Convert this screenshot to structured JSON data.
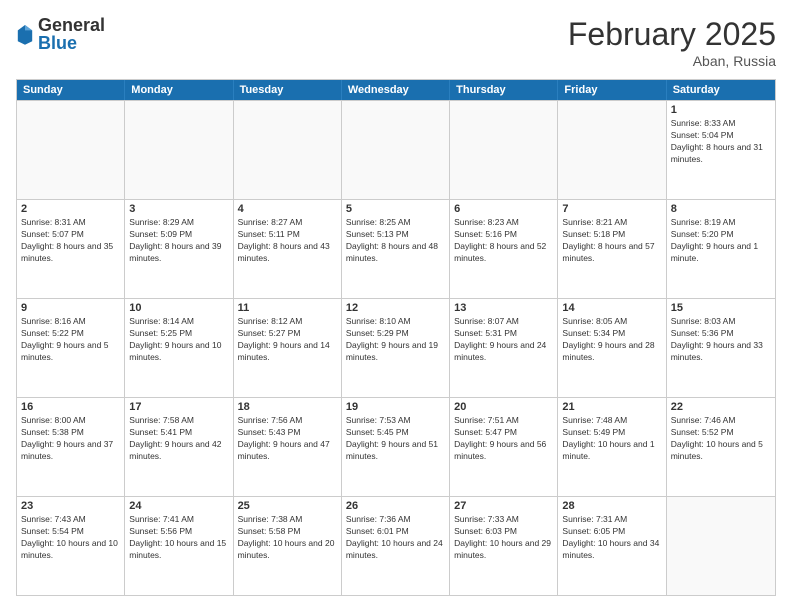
{
  "header": {
    "logo": {
      "general": "General",
      "blue": "Blue"
    },
    "title": "February 2025",
    "location": "Aban, Russia"
  },
  "weekdays": [
    "Sunday",
    "Monday",
    "Tuesday",
    "Wednesday",
    "Thursday",
    "Friday",
    "Saturday"
  ],
  "rows": [
    [
      {
        "date": "",
        "info": ""
      },
      {
        "date": "",
        "info": ""
      },
      {
        "date": "",
        "info": ""
      },
      {
        "date": "",
        "info": ""
      },
      {
        "date": "",
        "info": ""
      },
      {
        "date": "",
        "info": ""
      },
      {
        "date": "1",
        "info": "Sunrise: 8:33 AM\nSunset: 5:04 PM\nDaylight: 8 hours and 31 minutes."
      }
    ],
    [
      {
        "date": "2",
        "info": "Sunrise: 8:31 AM\nSunset: 5:07 PM\nDaylight: 8 hours and 35 minutes."
      },
      {
        "date": "3",
        "info": "Sunrise: 8:29 AM\nSunset: 5:09 PM\nDaylight: 8 hours and 39 minutes."
      },
      {
        "date": "4",
        "info": "Sunrise: 8:27 AM\nSunset: 5:11 PM\nDaylight: 8 hours and 43 minutes."
      },
      {
        "date": "5",
        "info": "Sunrise: 8:25 AM\nSunset: 5:13 PM\nDaylight: 8 hours and 48 minutes."
      },
      {
        "date": "6",
        "info": "Sunrise: 8:23 AM\nSunset: 5:16 PM\nDaylight: 8 hours and 52 minutes."
      },
      {
        "date": "7",
        "info": "Sunrise: 8:21 AM\nSunset: 5:18 PM\nDaylight: 8 hours and 57 minutes."
      },
      {
        "date": "8",
        "info": "Sunrise: 8:19 AM\nSunset: 5:20 PM\nDaylight: 9 hours and 1 minute."
      }
    ],
    [
      {
        "date": "9",
        "info": "Sunrise: 8:16 AM\nSunset: 5:22 PM\nDaylight: 9 hours and 5 minutes."
      },
      {
        "date": "10",
        "info": "Sunrise: 8:14 AM\nSunset: 5:25 PM\nDaylight: 9 hours and 10 minutes."
      },
      {
        "date": "11",
        "info": "Sunrise: 8:12 AM\nSunset: 5:27 PM\nDaylight: 9 hours and 14 minutes."
      },
      {
        "date": "12",
        "info": "Sunrise: 8:10 AM\nSunset: 5:29 PM\nDaylight: 9 hours and 19 minutes."
      },
      {
        "date": "13",
        "info": "Sunrise: 8:07 AM\nSunset: 5:31 PM\nDaylight: 9 hours and 24 minutes."
      },
      {
        "date": "14",
        "info": "Sunrise: 8:05 AM\nSunset: 5:34 PM\nDaylight: 9 hours and 28 minutes."
      },
      {
        "date": "15",
        "info": "Sunrise: 8:03 AM\nSunset: 5:36 PM\nDaylight: 9 hours and 33 minutes."
      }
    ],
    [
      {
        "date": "16",
        "info": "Sunrise: 8:00 AM\nSunset: 5:38 PM\nDaylight: 9 hours and 37 minutes."
      },
      {
        "date": "17",
        "info": "Sunrise: 7:58 AM\nSunset: 5:41 PM\nDaylight: 9 hours and 42 minutes."
      },
      {
        "date": "18",
        "info": "Sunrise: 7:56 AM\nSunset: 5:43 PM\nDaylight: 9 hours and 47 minutes."
      },
      {
        "date": "19",
        "info": "Sunrise: 7:53 AM\nSunset: 5:45 PM\nDaylight: 9 hours and 51 minutes."
      },
      {
        "date": "20",
        "info": "Sunrise: 7:51 AM\nSunset: 5:47 PM\nDaylight: 9 hours and 56 minutes."
      },
      {
        "date": "21",
        "info": "Sunrise: 7:48 AM\nSunset: 5:49 PM\nDaylight: 10 hours and 1 minute."
      },
      {
        "date": "22",
        "info": "Sunrise: 7:46 AM\nSunset: 5:52 PM\nDaylight: 10 hours and 5 minutes."
      }
    ],
    [
      {
        "date": "23",
        "info": "Sunrise: 7:43 AM\nSunset: 5:54 PM\nDaylight: 10 hours and 10 minutes."
      },
      {
        "date": "24",
        "info": "Sunrise: 7:41 AM\nSunset: 5:56 PM\nDaylight: 10 hours and 15 minutes."
      },
      {
        "date": "25",
        "info": "Sunrise: 7:38 AM\nSunset: 5:58 PM\nDaylight: 10 hours and 20 minutes."
      },
      {
        "date": "26",
        "info": "Sunrise: 7:36 AM\nSunset: 6:01 PM\nDaylight: 10 hours and 24 minutes."
      },
      {
        "date": "27",
        "info": "Sunrise: 7:33 AM\nSunset: 6:03 PM\nDaylight: 10 hours and 29 minutes."
      },
      {
        "date": "28",
        "info": "Sunrise: 7:31 AM\nSunset: 6:05 PM\nDaylight: 10 hours and 34 minutes."
      },
      {
        "date": "",
        "info": ""
      }
    ]
  ]
}
